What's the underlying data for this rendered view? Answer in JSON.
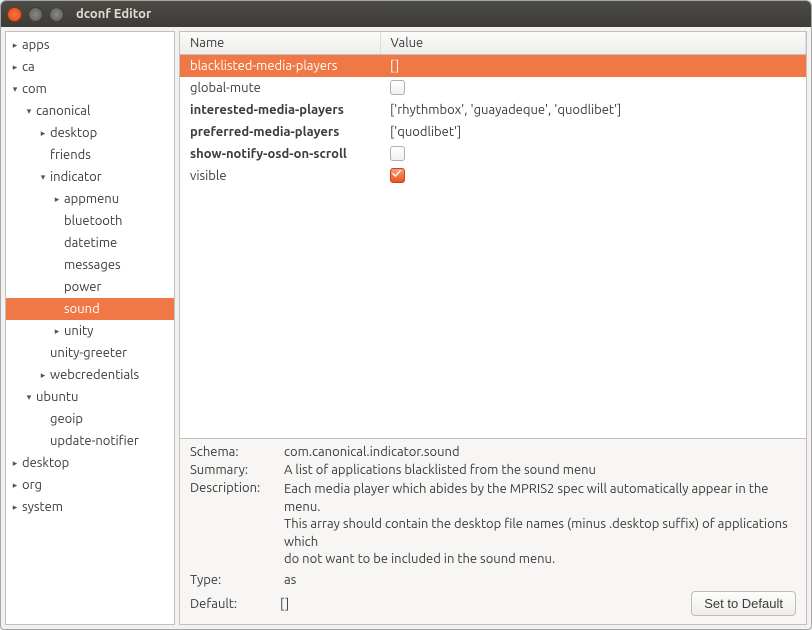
{
  "window": {
    "title": "dconf Editor"
  },
  "tree": [
    {
      "label": "apps",
      "indent": 0,
      "arrow": "right"
    },
    {
      "label": "ca",
      "indent": 0,
      "arrow": "right"
    },
    {
      "label": "com",
      "indent": 0,
      "arrow": "down"
    },
    {
      "label": "canonical",
      "indent": 1,
      "arrow": "down"
    },
    {
      "label": "desktop",
      "indent": 2,
      "arrow": "right"
    },
    {
      "label": "friends",
      "indent": 2,
      "arrow": ""
    },
    {
      "label": "indicator",
      "indent": 2,
      "arrow": "down"
    },
    {
      "label": "appmenu",
      "indent": 3,
      "arrow": "right"
    },
    {
      "label": "bluetooth",
      "indent": 3,
      "arrow": ""
    },
    {
      "label": "datetime",
      "indent": 3,
      "arrow": ""
    },
    {
      "label": "messages",
      "indent": 3,
      "arrow": ""
    },
    {
      "label": "power",
      "indent": 3,
      "arrow": ""
    },
    {
      "label": "sound",
      "indent": 3,
      "arrow": "",
      "selected": true
    },
    {
      "label": "unity",
      "indent": 3,
      "arrow": "right"
    },
    {
      "label": "unity-greeter",
      "indent": 2,
      "arrow": ""
    },
    {
      "label": "webcredentials",
      "indent": 2,
      "arrow": "right"
    },
    {
      "label": "ubuntu",
      "indent": 1,
      "arrow": "down"
    },
    {
      "label": "geoip",
      "indent": 2,
      "arrow": ""
    },
    {
      "label": "update-notifier",
      "indent": 2,
      "arrow": ""
    },
    {
      "label": "desktop",
      "indent": 0,
      "arrow": "right"
    },
    {
      "label": "org",
      "indent": 0,
      "arrow": "right"
    },
    {
      "label": "system",
      "indent": 0,
      "arrow": "right"
    }
  ],
  "table": {
    "headers": {
      "name": "Name",
      "value": "Value"
    },
    "rows": [
      {
        "name": "blacklisted-media-players",
        "value_text": "[]",
        "type": "text",
        "bold": false,
        "selected": true
      },
      {
        "name": "global-mute",
        "value_text": "",
        "type": "check",
        "checked": false,
        "bold": false
      },
      {
        "name": "interested-media-players",
        "value_text": "['rhythmbox', 'guayadeque', 'quodlibet']",
        "type": "text",
        "bold": true
      },
      {
        "name": "preferred-media-players",
        "value_text": "['quodlibet']",
        "type": "text",
        "bold": true
      },
      {
        "name": "show-notify-osd-on-scroll",
        "value_text": "",
        "type": "check",
        "checked": false,
        "bold": true
      },
      {
        "name": "visible",
        "value_text": "",
        "type": "check",
        "checked": true,
        "bold": false
      }
    ]
  },
  "details": {
    "labels": {
      "schema": "Schema:",
      "summary": "Summary:",
      "description": "Description:",
      "type": "Type:",
      "default": "Default:"
    },
    "schema": "com.canonical.indicator.sound",
    "summary": "A list of applications blacklisted from the sound menu",
    "description": "Each media player which abides by the MPRIS2 spec will automatically appear in the menu.\n      This array should contain the desktop file names (minus .desktop suffix) of applications which\n      do not want to be included in the sound menu.",
    "type": "as",
    "default": "[]",
    "set_default_label": "Set to Default"
  }
}
